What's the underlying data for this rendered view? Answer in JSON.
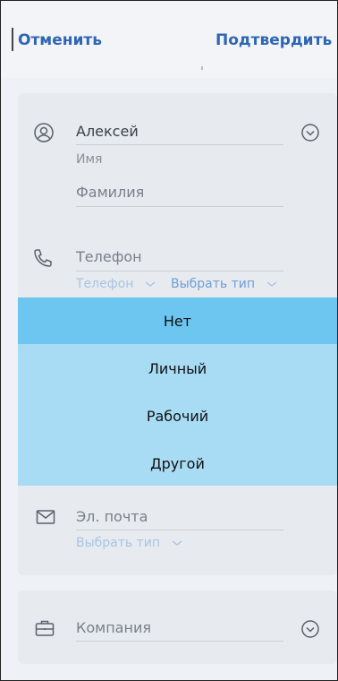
{
  "header": {
    "cancel_label": "Отменить",
    "confirm_label": "Подтвердить"
  },
  "name": {
    "first_name_value": "Алексей",
    "first_name_hint": "Имя",
    "last_name_placeholder": "Фамилия"
  },
  "phone": {
    "placeholder": "Телефон",
    "type_label": "Телефон",
    "choose_type_label": "Выбрать тип"
  },
  "dropdown": {
    "options": [
      "Нет",
      "Личный",
      "Рабочий",
      "Другой"
    ],
    "selected": "Нет"
  },
  "email": {
    "placeholder": "Эл. почта",
    "choose_type_label": "Выбрать тип"
  },
  "company": {
    "placeholder": "Компания"
  },
  "colors": {
    "accent": "#2f66b3",
    "dropdown_bg": "#a7dcf4",
    "dropdown_selected": "#6cc6f0"
  }
}
